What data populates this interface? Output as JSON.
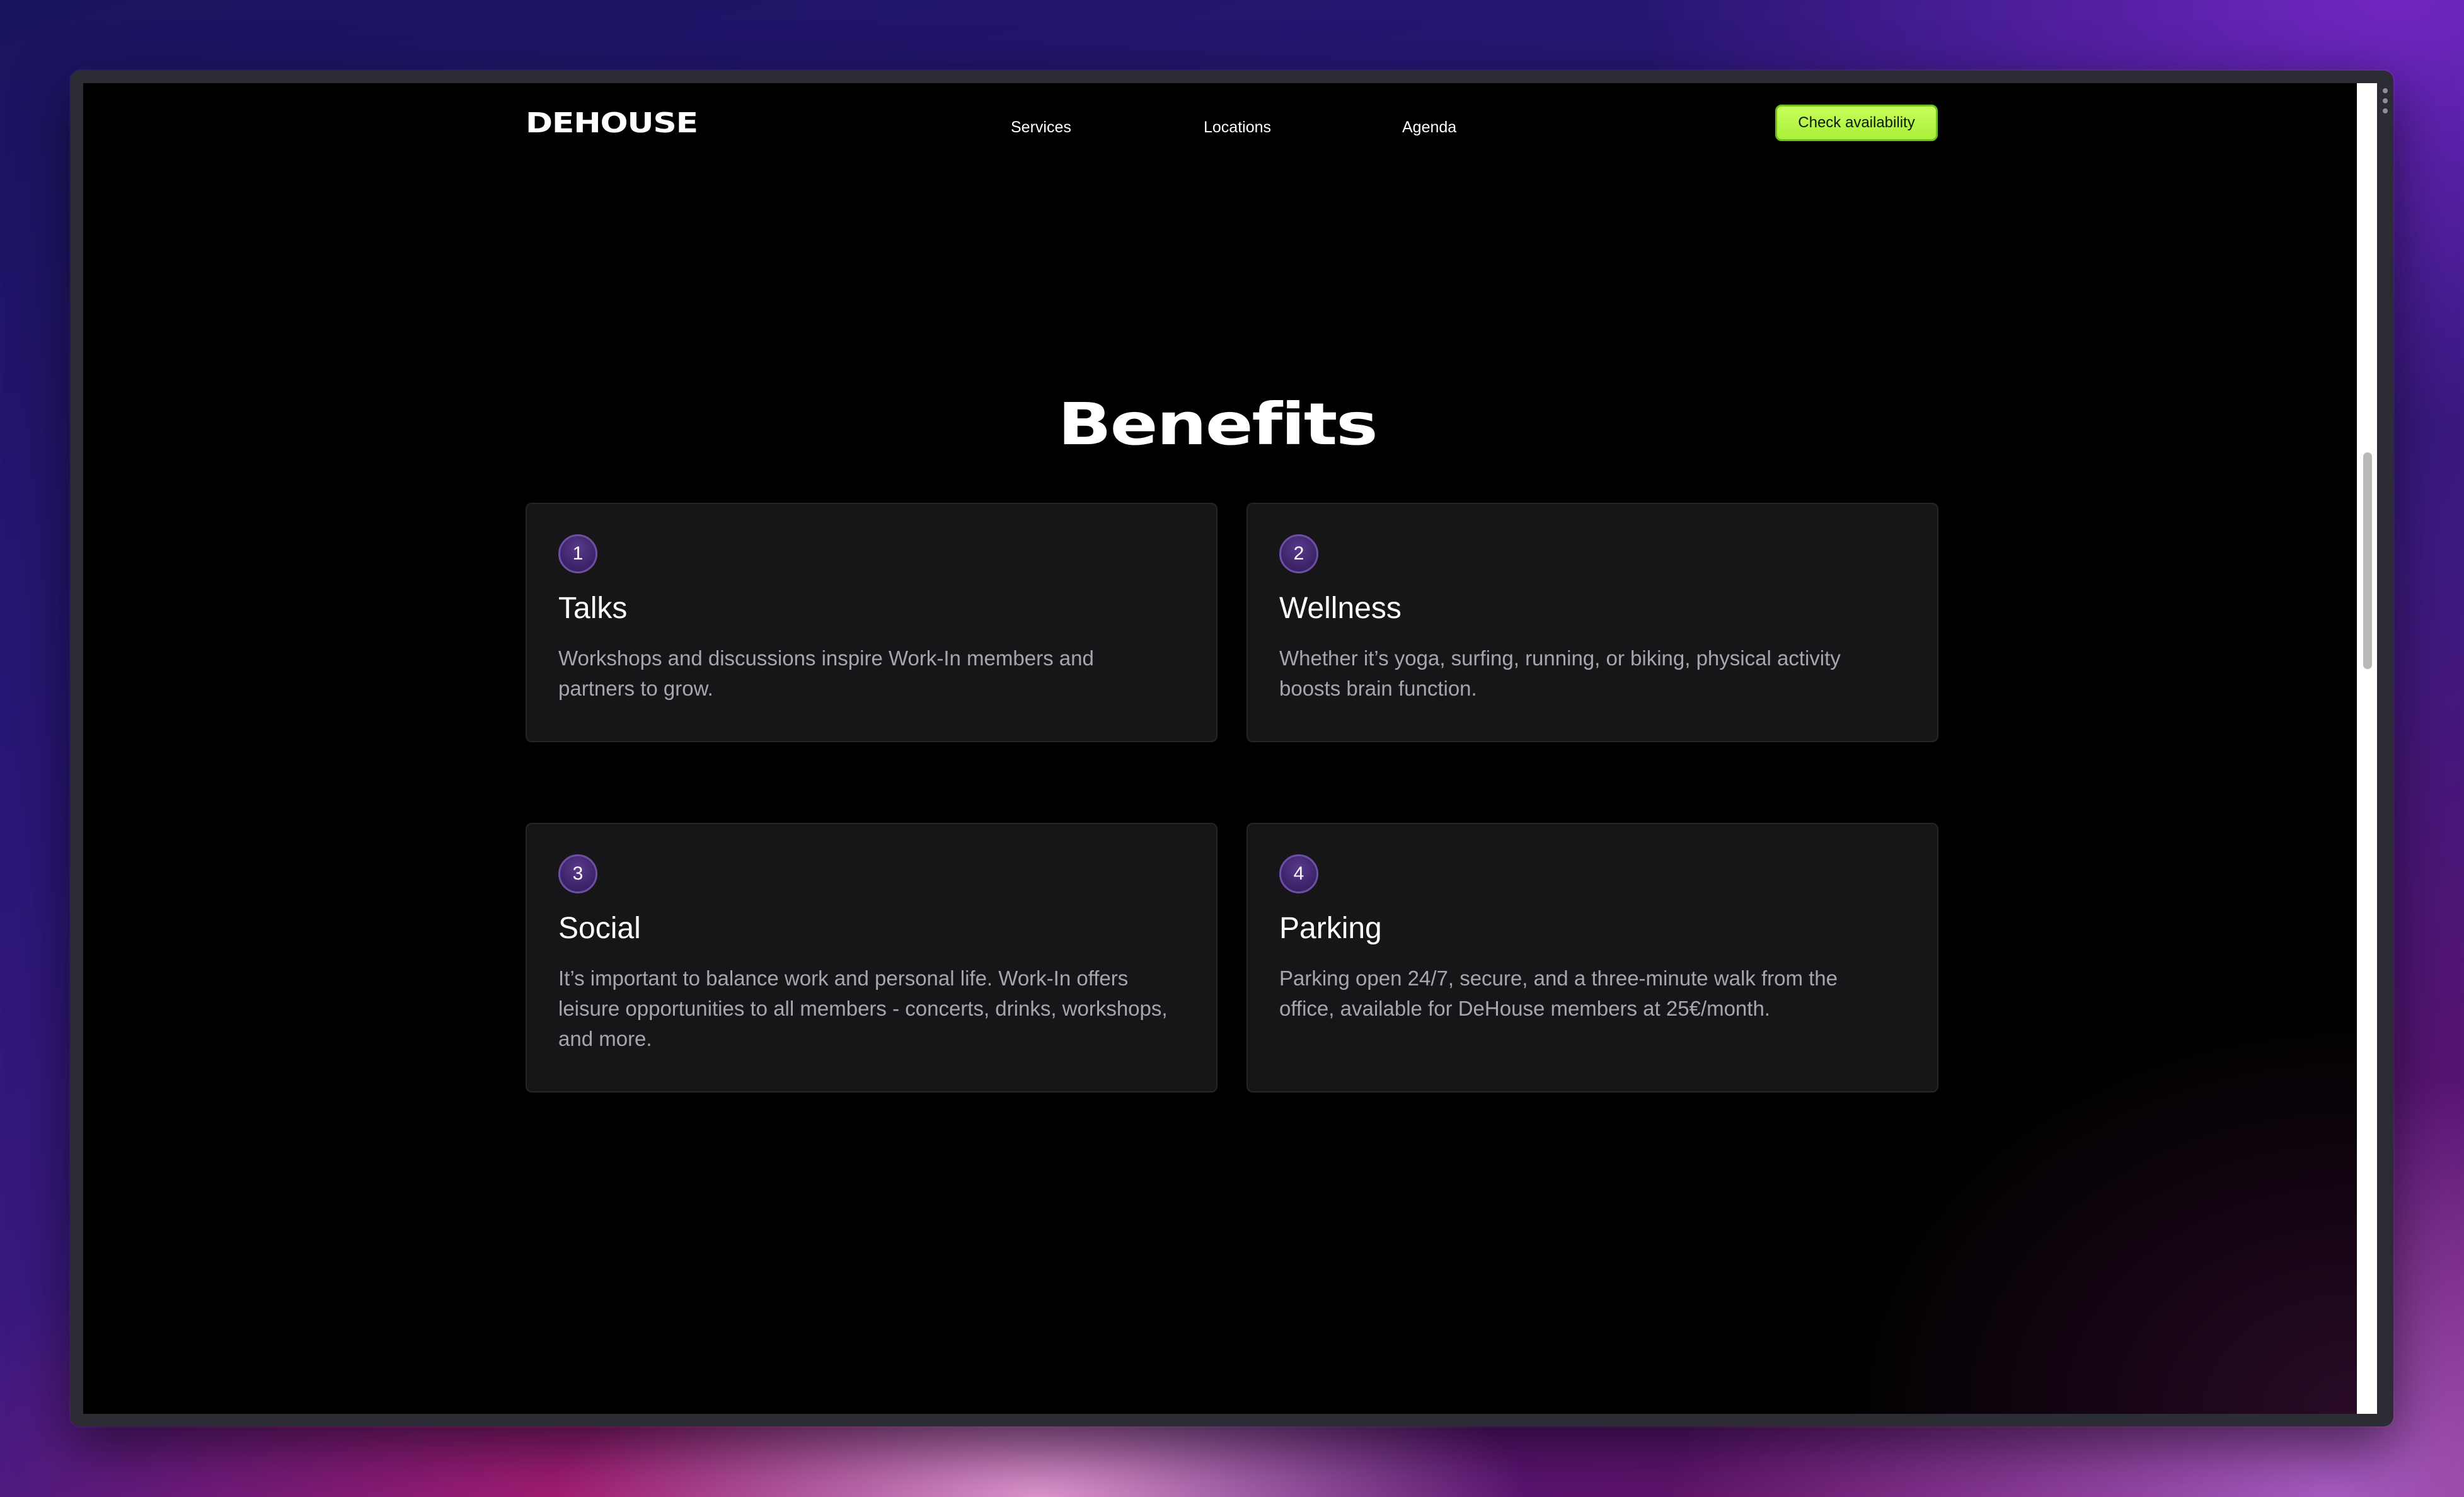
{
  "header": {
    "logo": "DEHOUSE",
    "nav": [
      "Services",
      "Locations",
      "Agenda"
    ],
    "cta_label": "Check availability"
  },
  "main": {
    "title": "Benefits",
    "cards": [
      {
        "number": "1",
        "title": "Talks",
        "description": "Workshops and discussions inspire Work-In members and partners to grow."
      },
      {
        "number": "2",
        "title": "Wellness",
        "description": "Whether it’s yoga, surfing, running, or biking, physical activity boosts brain function."
      },
      {
        "number": "3",
        "title": "Social",
        "description": "It’s important to balance work and personal life. Work-In offers leisure opportunities to all members - concerts, drinks, workshops, and more."
      },
      {
        "number": "4",
        "title": "Parking",
        "description": "Parking open 24/7, secure, and a three-minute walk from the office, available for DeHouse members at 25€/month."
      }
    ]
  },
  "colors": {
    "accent": "#b6f84a",
    "background": "#000000",
    "card": "#161618",
    "badge": "#3a2266"
  }
}
